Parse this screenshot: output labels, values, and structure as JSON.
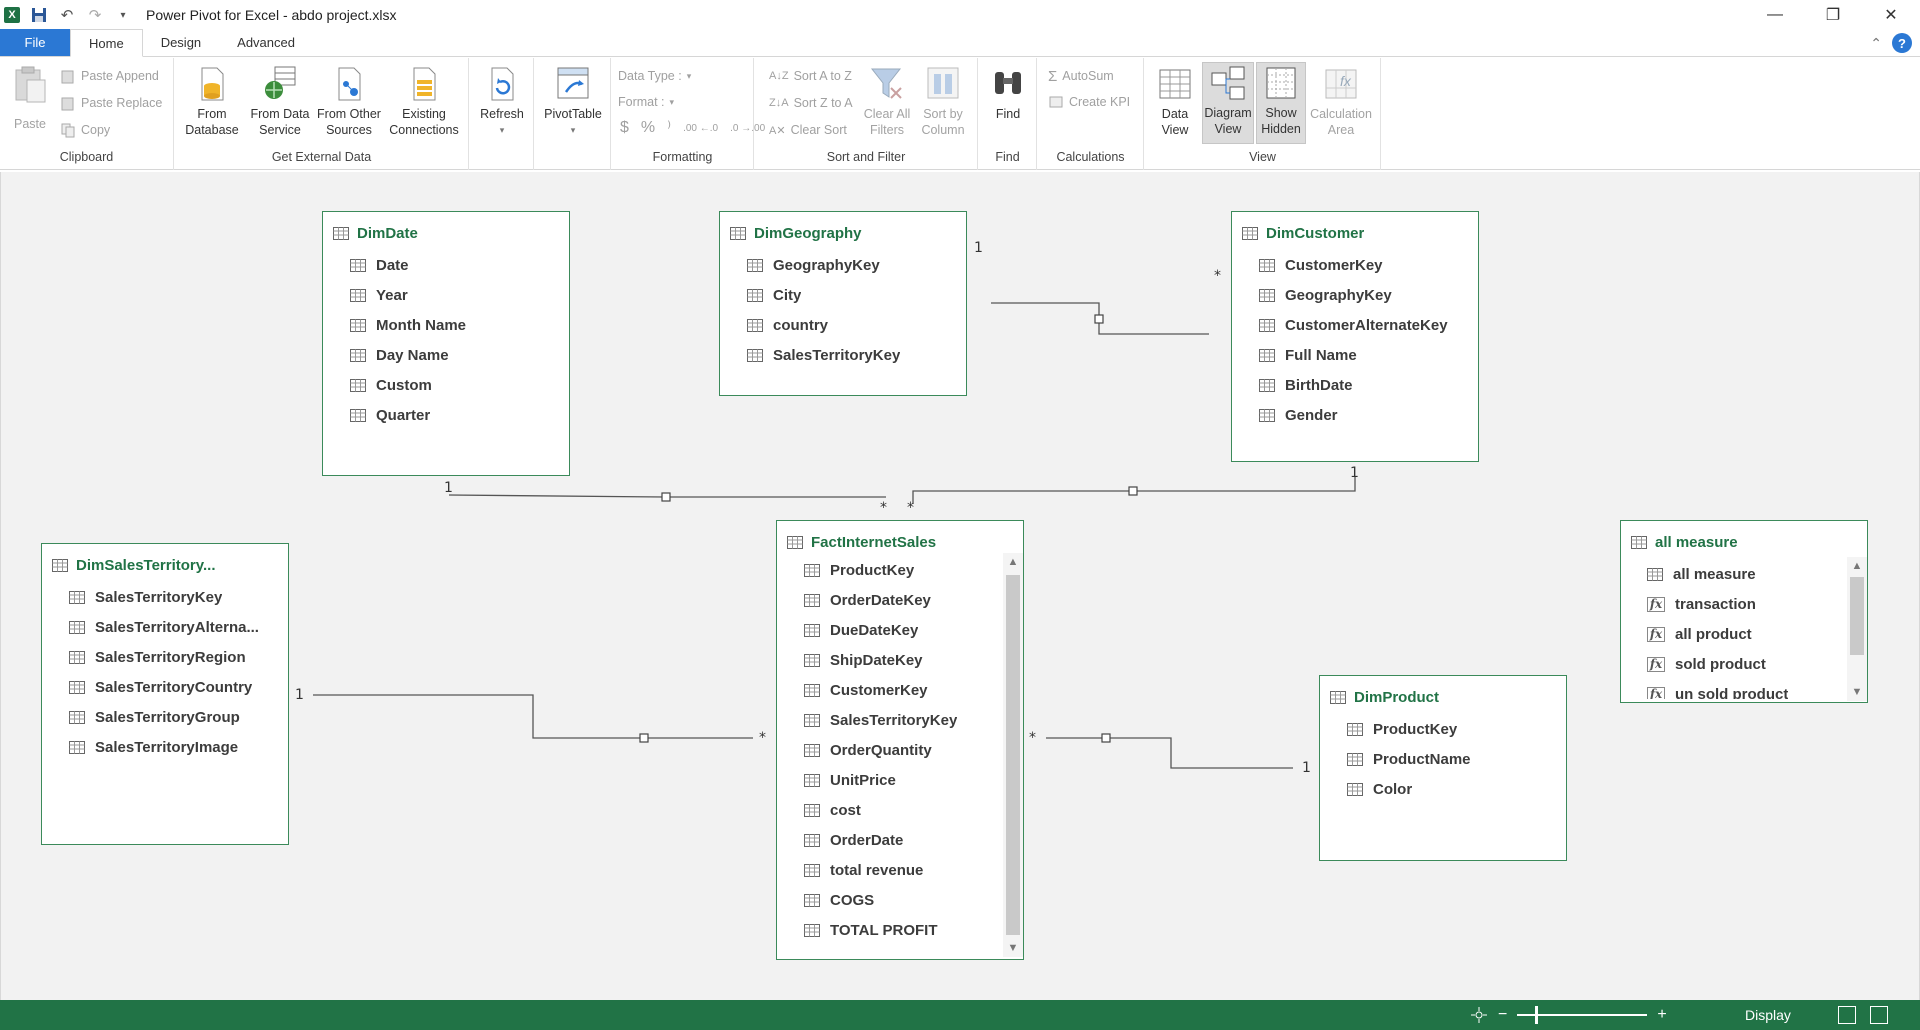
{
  "window": {
    "title": "Power Pivot for Excel - abdo project.xlsx",
    "min": "—",
    "restore": "❐",
    "close": "✕"
  },
  "tabs": [
    "File",
    "Home",
    "Design",
    "Advanced"
  ],
  "help": "?",
  "ribbon": {
    "clipboard": {
      "label": "Clipboard",
      "paste": "Paste",
      "paste_append": "Paste Append",
      "paste_replace": "Paste Replace",
      "copy": "Copy"
    },
    "external": {
      "label": "Get External Data",
      "from_database": [
        "From",
        "Database"
      ],
      "from_data_service": [
        "From Data",
        "Service"
      ],
      "from_other_sources": [
        "From Other",
        "Sources"
      ],
      "existing_connections": [
        "Existing",
        "Connections"
      ]
    },
    "refresh": "Refresh",
    "pivottable": "PivotTable",
    "formatting": {
      "label": "Formatting",
      "data_type": "Data Type :",
      "format": "Format :",
      "currency": "$",
      "percent": "%",
      "comma": "⁾",
      "inc": ".00 ←.0",
      "dec": ".0 →.00"
    },
    "sortfilter": {
      "label": "Sort and Filter",
      "sort_az": "Sort A to Z",
      "sort_za": "Sort Z to A",
      "clear_sort": "Clear Sort",
      "clear_all_filters": [
        "Clear All",
        "Filters"
      ],
      "sort_by_column": [
        "Sort by",
        "Column"
      ]
    },
    "find": {
      "label": "Find",
      "button": "Find"
    },
    "calculations": {
      "label": "Calculations",
      "autosum": "AutoSum",
      "create_kpi": "Create KPI"
    },
    "view": {
      "label": "View",
      "data_view": [
        "Data",
        "View"
      ],
      "diagram_view": [
        "Diagram",
        "View"
      ],
      "show_hidden": [
        "Show",
        "Hidden"
      ],
      "calculation_area": [
        "Calculation",
        "Area"
      ]
    }
  },
  "tables": {
    "dimdate": {
      "name": "DimDate",
      "fields": [
        "Date",
        "Year",
        "Month Name",
        "Day Name",
        "Custom",
        "Quarter"
      ]
    },
    "dimgeography": {
      "name": "DimGeography",
      "fields": [
        "GeographyKey",
        "City",
        "country",
        "SalesTerritoryKey"
      ]
    },
    "dimcustomer": {
      "name": "DimCustomer",
      "fields": [
        "CustomerKey",
        "GeographyKey",
        "CustomerAlternateKey",
        "Full Name",
        "BirthDate",
        "Gender"
      ]
    },
    "dimsalesterritory": {
      "name": "DimSalesTerritory...",
      "fields": [
        "SalesTerritoryKey",
        "SalesTerritoryAlterna...",
        "SalesTerritoryRegion",
        "SalesTerritoryCountry",
        "SalesTerritoryGroup",
        "SalesTerritoryImage"
      ]
    },
    "factinternetsales": {
      "name": "FactInternetSales",
      "fields": [
        "ProductKey",
        "OrderDateKey",
        "DueDateKey",
        "ShipDateKey",
        "CustomerKey",
        "SalesTerritoryKey",
        "OrderQuantity",
        "UnitPrice",
        "cost",
        "OrderDate",
        "total revenue",
        "COGS",
        "TOTAL PROFIT"
      ]
    },
    "dimproduct": {
      "name": "DimProduct",
      "fields": [
        "ProductKey",
        "ProductName",
        "Color"
      ]
    },
    "allmeasure": {
      "name": "all measure",
      "fields": [
        "all measure",
        "transaction",
        "all product",
        "sold product",
        "un sold product"
      ]
    }
  },
  "cardinality": {
    "one": "1",
    "many": "*"
  },
  "status": {
    "display": "Display",
    "zoom_out": "−",
    "zoom_in": "+"
  }
}
